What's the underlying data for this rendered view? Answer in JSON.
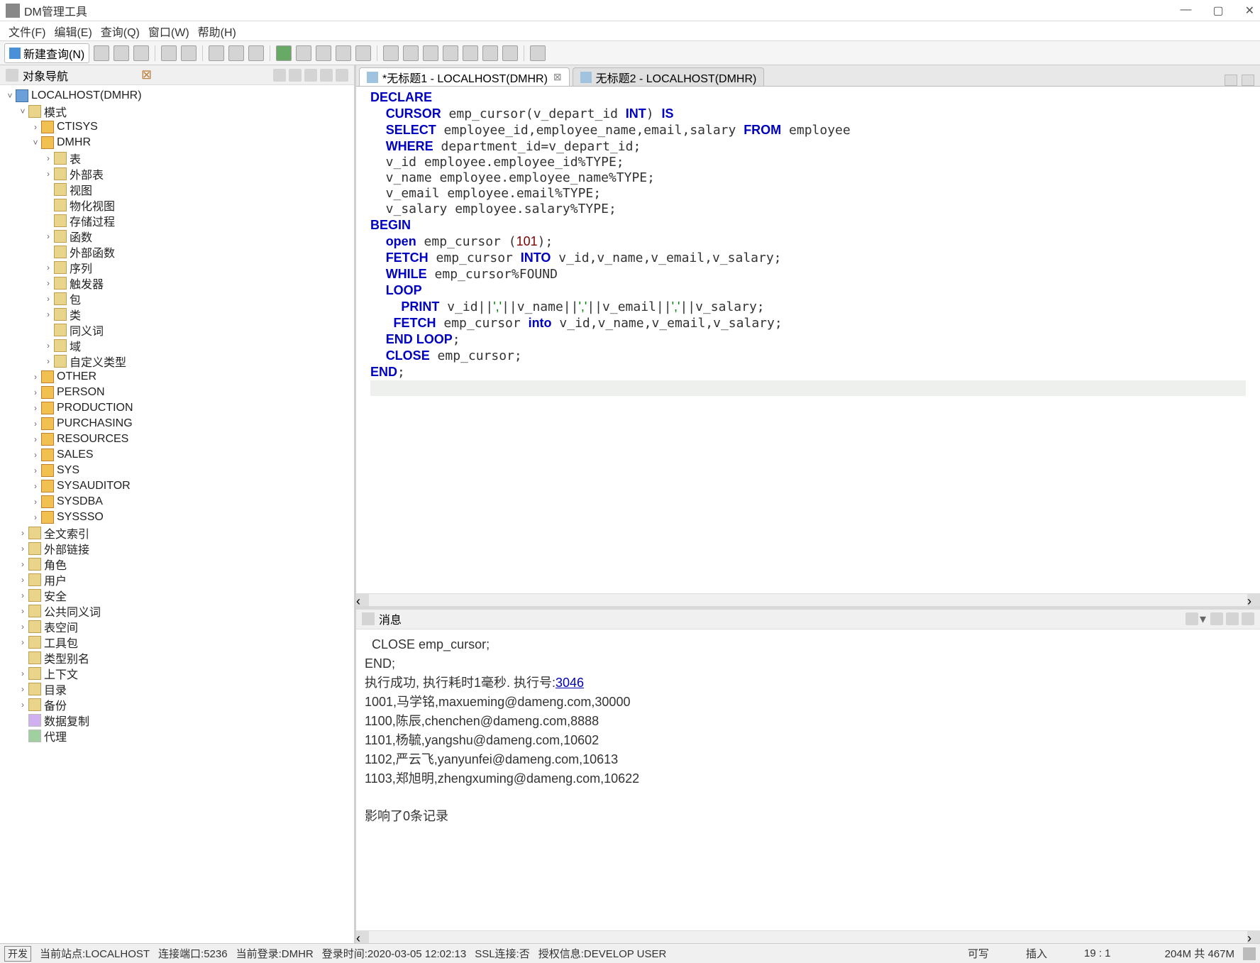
{
  "window": {
    "title": "DM管理工具",
    "minimize": "—",
    "maximize": "▢",
    "close": "✕"
  },
  "menu": {
    "file": "文件(F)",
    "edit": "编辑(E)",
    "query": "查询(Q)",
    "window": "窗口(W)",
    "help": "帮助(H)"
  },
  "toolbar": {
    "new_query": "新建查询(N)"
  },
  "sidebar": {
    "title": "对象导航",
    "root": "LOCALHOST(DMHR)",
    "schema_label": "模式",
    "schemas": {
      "ctisys": "CTISYS",
      "dmhr": "DMHR",
      "other": "OTHER",
      "person": "PERSON",
      "production": "PRODUCTION",
      "purchasing": "PURCHASING",
      "resources": "RESOURCES",
      "sales": "SALES",
      "sys": "SYS",
      "sysauditor": "SYSAUDITOR",
      "sysdba": "SYSDBA",
      "syssso": "SYSSSO"
    },
    "dmhr_items": {
      "table": "表",
      "ext_table": "外部表",
      "view": "视图",
      "mview": "物化视图",
      "proc": "存储过程",
      "func": "函数",
      "ext_func": "外部函数",
      "seq": "序列",
      "trigger": "触发器",
      "pkg": "包",
      "class": "类",
      "synonym": "同义词",
      "domain": "域",
      "custom_type": "自定义类型"
    },
    "items": {
      "fulltext": "全文索引",
      "dblink": "外部链接",
      "role": "角色",
      "user": "用户",
      "security": "安全",
      "pub_synonym": "公共同义词",
      "tablespace": "表空间",
      "toolkit": "工具包",
      "type_alias": "类型别名",
      "context": "上下文",
      "directory": "目录",
      "backup": "备份",
      "replicate": "数据复制",
      "agent": "代理"
    }
  },
  "tabs": {
    "t1": "*无标题1 - LOCALHOST(DMHR)",
    "t2": "无标题2 - LOCALHOST(DMHR)"
  },
  "output": {
    "title": "消息",
    "line1": "  CLOSE emp_cursor;",
    "line2": "END;",
    "exec_prefix": "执行成功, 执行耗时1毫秒. 执行号:",
    "exec_id": "3046",
    "r1": "1001,马学铭,maxueming@dameng.com,30000",
    "r2": "1100,陈辰,chenchen@dameng.com,8888",
    "r3": "1101,杨毓,yangshu@dameng.com,10602",
    "r4": "1102,严云飞,yanyunfei@dameng.com,10613",
    "r5": "1103,郑旭明,zhengxuming@dameng.com,10622",
    "affected": "影响了0条记录"
  },
  "status": {
    "dev": "开发",
    "site": "当前站点:LOCALHOST",
    "port": "连接端口:5236",
    "login": "当前登录:DMHR",
    "time": "登录时间:2020-03-05 12:02:13",
    "ssl": "SSL连接:否",
    "auth": "授权信息:DEVELOP USER",
    "writable": "可写",
    "insert": "插入",
    "pos": "19 : 1",
    "mem": "204M 共 467M"
  }
}
